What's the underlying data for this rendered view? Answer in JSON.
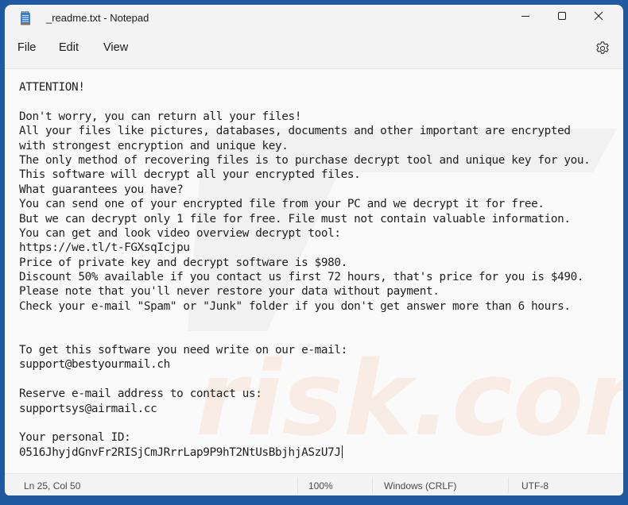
{
  "window": {
    "title": "_readme.txt - Notepad",
    "app_icon": "notepad-icon",
    "controls": {
      "minimize": "minimize-icon",
      "maximize": "maximize-icon",
      "close": "close-icon"
    },
    "frame_color": "#1f5aa0"
  },
  "menu": {
    "items": [
      {
        "label": "File"
      },
      {
        "label": "Edit"
      },
      {
        "label": "View"
      }
    ],
    "settings_icon": "gear-icon"
  },
  "editor": {
    "lines": [
      "ATTENTION!",
      "",
      "Don't worry, you can return all your files!",
      "All your files like pictures, databases, documents and other important are encrypted",
      "with strongest encryption and unique key.",
      "The only method of recovering files is to purchase decrypt tool and unique key for you.",
      "This software will decrypt all your encrypted files.",
      "What guarantees you have?",
      "You can send one of your encrypted file from your PC and we decrypt it for free.",
      "But we can decrypt only 1 file for free. File must not contain valuable information.",
      "You can get and look video overview decrypt tool:",
      "https://we.tl/t-FGXsqIcjpu",
      "Price of private key and decrypt software is $980.",
      "Discount 50% available if you contact us first 72 hours, that's price for you is $490.",
      "Please note that you'll never restore your data without payment.",
      "Check your e-mail \"Spam\" or \"Junk\" folder if you don't get answer more than 6 hours.",
      "",
      "",
      "To get this software you need write on our e-mail:",
      "support@bestyourmail.ch",
      "",
      "Reserve e-mail address to contact us:",
      "supportsys@airmail.cc",
      "",
      "Your personal ID:",
      "0516JhyjdGnvFr2RISjCmJRrrLap9P9hT2NtUsBbjhjASzU7J"
    ],
    "watermark_text": "risk.com"
  },
  "status": {
    "position": "Ln 25, Col 50",
    "zoom": "100%",
    "line_ending": "Windows (CRLF)",
    "encoding": "UTF-8"
  }
}
